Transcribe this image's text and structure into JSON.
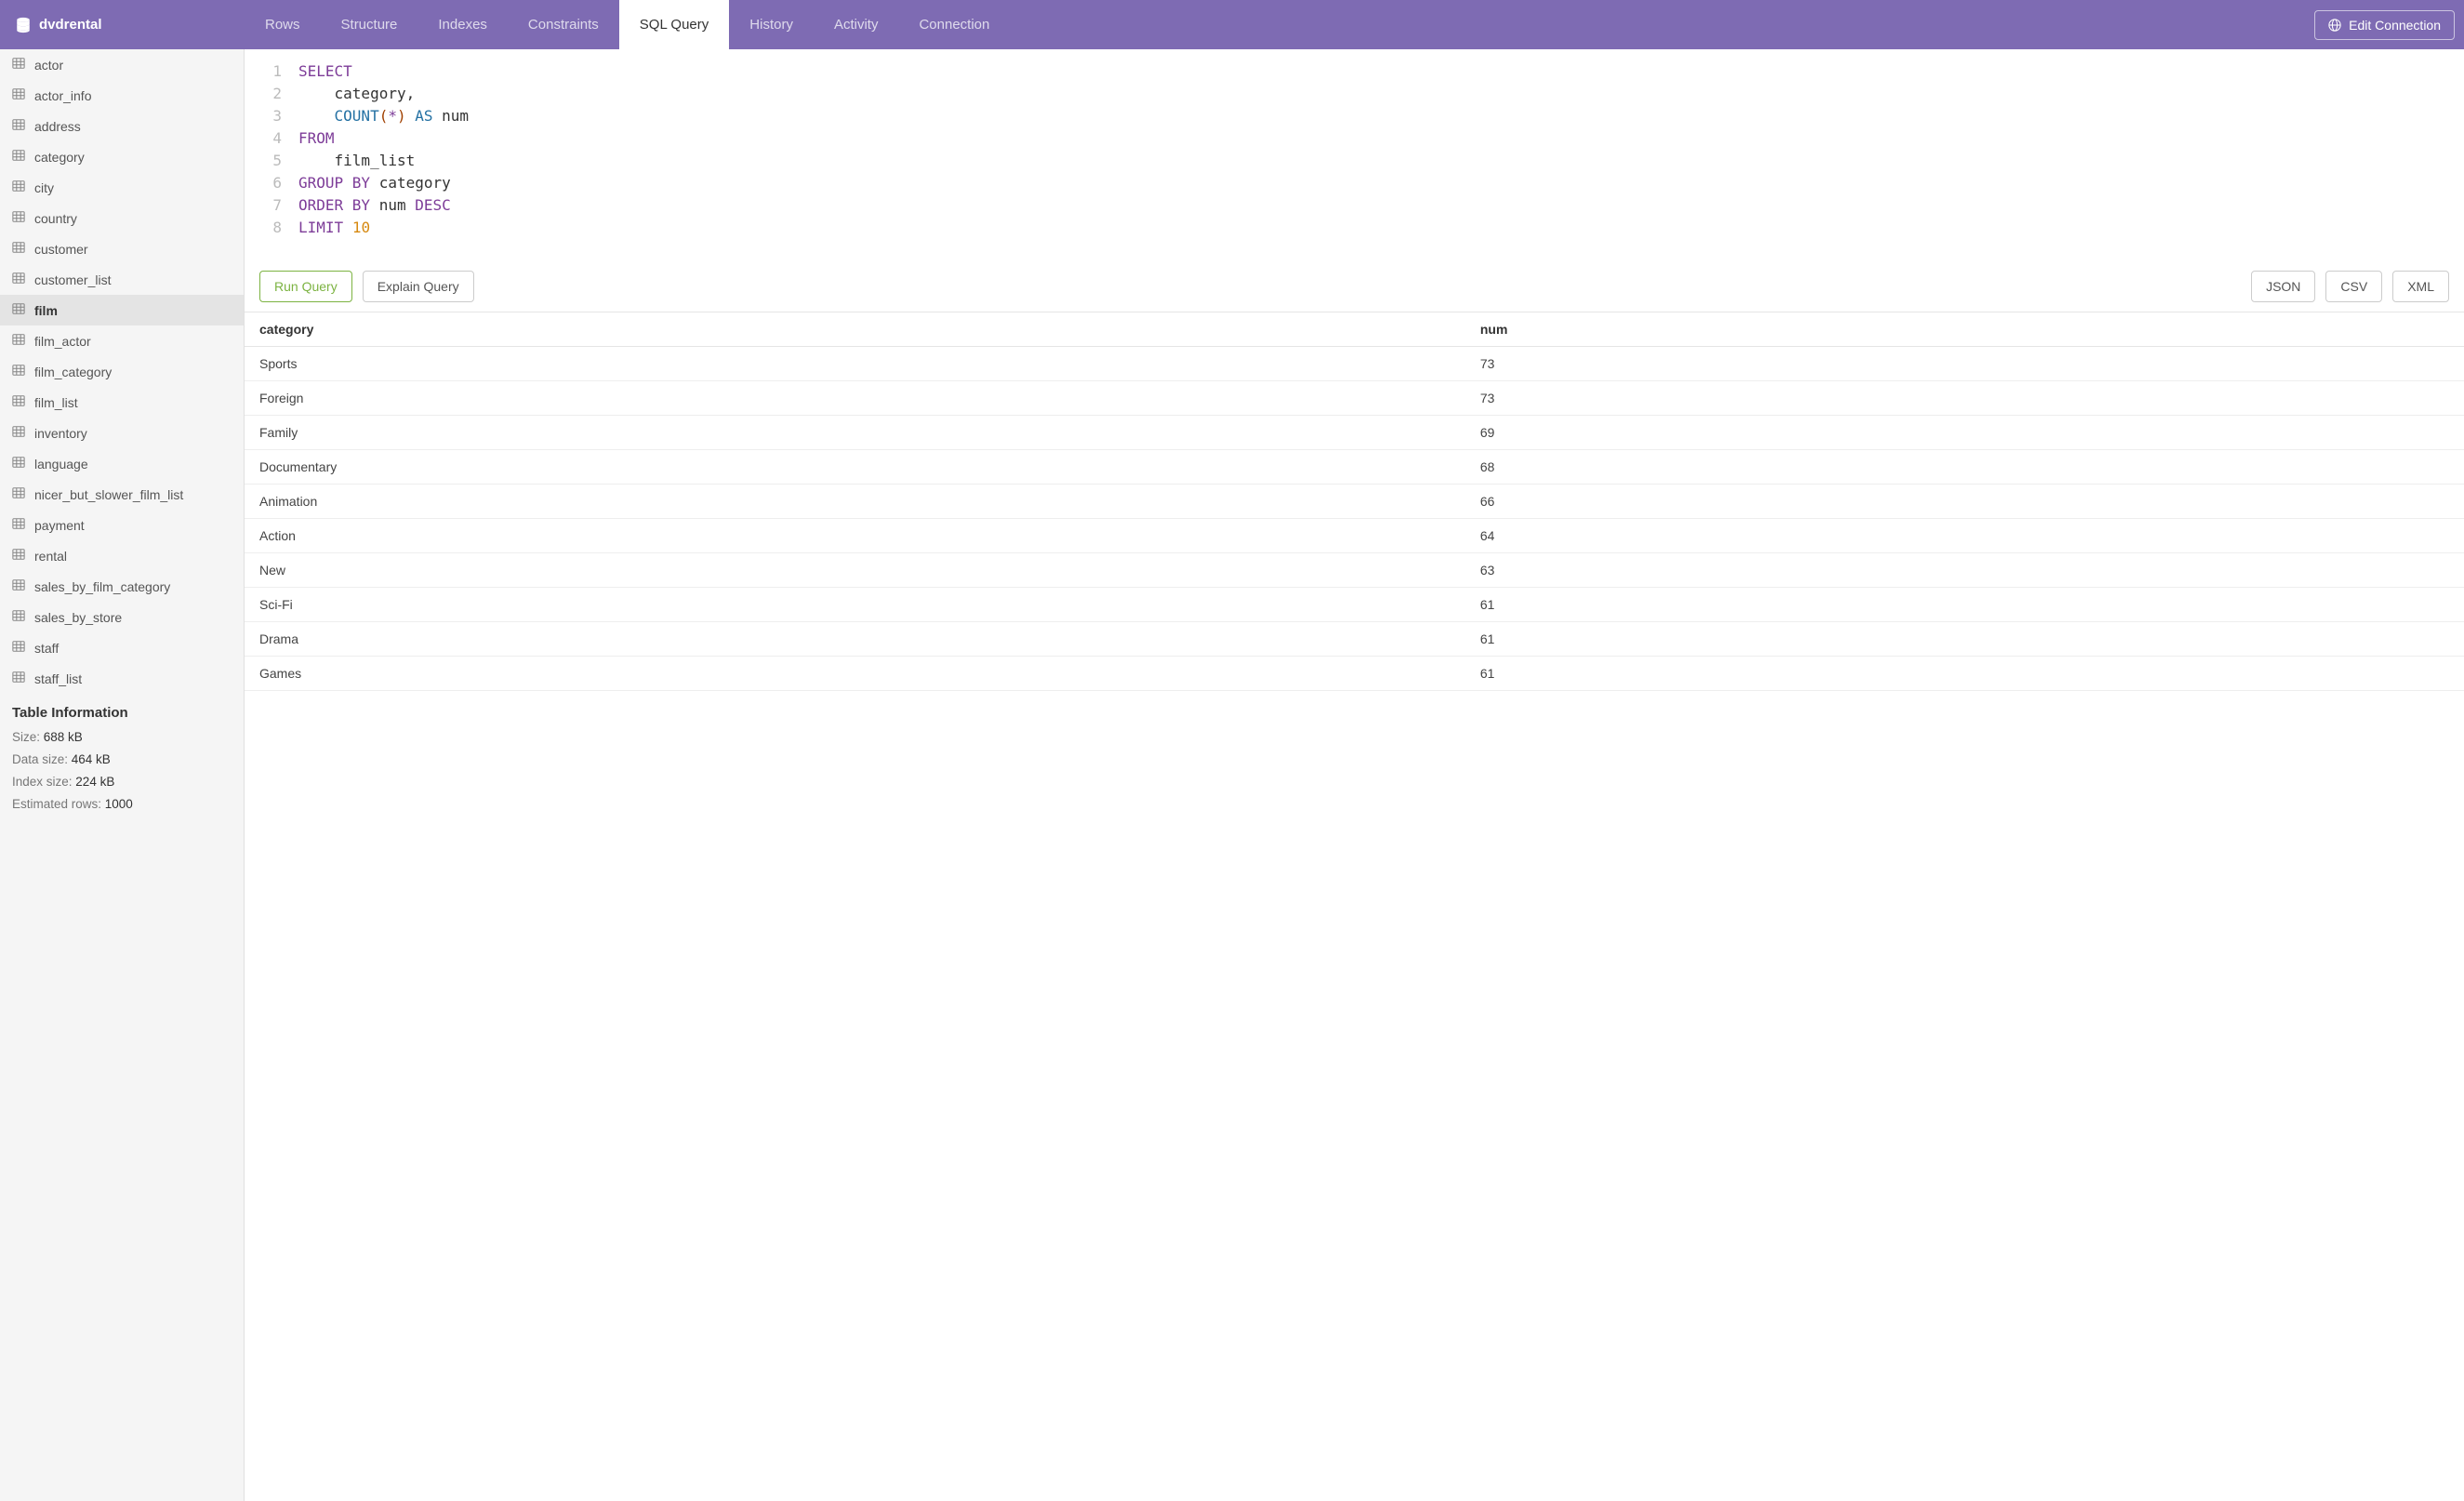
{
  "header": {
    "brand": "dvdrental",
    "tabs": [
      "Rows",
      "Structure",
      "Indexes",
      "Constraints",
      "SQL Query",
      "History",
      "Activity",
      "Connection"
    ],
    "active_tab": "SQL Query",
    "edit_connection": "Edit Connection"
  },
  "sidebar": {
    "tables": [
      "actor",
      "actor_info",
      "address",
      "category",
      "city",
      "country",
      "customer",
      "customer_list",
      "film",
      "film_actor",
      "film_category",
      "film_list",
      "inventory",
      "language",
      "nicer_but_slower_film_list",
      "payment",
      "rental",
      "sales_by_film_category",
      "sales_by_store",
      "staff",
      "staff_list"
    ],
    "active_table": "film",
    "info_title": "Table Information",
    "info": [
      {
        "label": "Size:",
        "value": "688 kB"
      },
      {
        "label": "Data size:",
        "value": "464 kB"
      },
      {
        "label": "Index size:",
        "value": "224 kB"
      },
      {
        "label": "Estimated rows:",
        "value": "1000"
      }
    ]
  },
  "sql": {
    "lines": [
      [
        {
          "t": "SELECT",
          "c": "kw"
        }
      ],
      [
        {
          "t": "    category,",
          "c": ""
        }
      ],
      [
        {
          "t": "    ",
          "c": ""
        },
        {
          "t": "COUNT",
          "c": "kw2"
        },
        {
          "t": "(",
          "c": "paren"
        },
        {
          "t": "*",
          "c": "kw"
        },
        {
          "t": ")",
          "c": "paren"
        },
        {
          "t": " ",
          "c": ""
        },
        {
          "t": "AS",
          "c": "kw2"
        },
        {
          "t": " num",
          "c": ""
        }
      ],
      [
        {
          "t": "FROM",
          "c": "kw"
        }
      ],
      [
        {
          "t": "    film_list",
          "c": ""
        }
      ],
      [
        {
          "t": "GROUP BY",
          "c": "kw"
        },
        {
          "t": " category",
          "c": ""
        }
      ],
      [
        {
          "t": "ORDER BY",
          "c": "kw"
        },
        {
          "t": " num ",
          "c": ""
        },
        {
          "t": "DESC",
          "c": "kw"
        }
      ],
      [
        {
          "t": "LIMIT",
          "c": "kw"
        },
        {
          "t": " ",
          "c": ""
        },
        {
          "t": "10",
          "c": "num"
        }
      ]
    ]
  },
  "actions": {
    "run": "Run Query",
    "explain": "Explain Query",
    "export": [
      "JSON",
      "CSV",
      "XML"
    ]
  },
  "results": {
    "columns": [
      "category",
      "num"
    ],
    "rows": [
      [
        "Sports",
        "73"
      ],
      [
        "Foreign",
        "73"
      ],
      [
        "Family",
        "69"
      ],
      [
        "Documentary",
        "68"
      ],
      [
        "Animation",
        "66"
      ],
      [
        "Action",
        "64"
      ],
      [
        "New",
        "63"
      ],
      [
        "Sci-Fi",
        "61"
      ],
      [
        "Drama",
        "61"
      ],
      [
        "Games",
        "61"
      ]
    ]
  }
}
